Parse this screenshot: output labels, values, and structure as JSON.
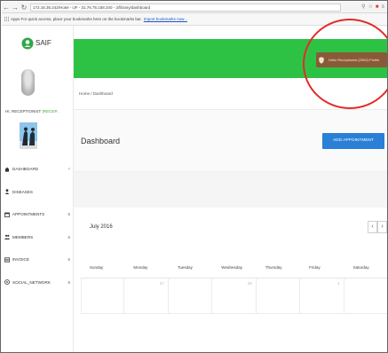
{
  "browser": {
    "url": "172.16.36.242/Hotel - UF - 31.76.75.158.340 - 2/library/dashboard",
    "bookmarks_text": "Apps  For quick access, place your bookmarks here on the bookmarks bar.",
    "bookmarks_link": "Import bookmarks now..."
  },
  "app": {
    "logo_text": "SAIF",
    "user_name_prefix": "HI, RECEPTIONIST ",
    "user_name_accent": "(RECEP..",
    "user_pill_text": "Hello Receptionist (2000)  Profile",
    "breadcrumb": "Home / Dashboard",
    "page_title": "Dashboard",
    "add_button": "ADD APPOINTMENT"
  },
  "sidebar": {
    "items": [
      {
        "label": "DASHBOARD",
        "count": "",
        "icon": "home-icon"
      },
      {
        "label": "DISEASES",
        "count": "",
        "icon": "user-icon"
      },
      {
        "label": "APPOINTMENTS",
        "count": "6",
        "icon": "calendar-icon"
      },
      {
        "label": "MEMBERS",
        "count": "6",
        "icon": "users-icon"
      },
      {
        "label": "INVOICE",
        "count": "6",
        "icon": "invoice-icon"
      },
      {
        "label": "SOCIAL_NETWORK",
        "count": "6",
        "icon": "network-icon"
      }
    ]
  },
  "calendar": {
    "month": "July 2016",
    "prev": "‹",
    "next": "›",
    "days": [
      "Sunday",
      "Monday",
      "Tuesday",
      "Wednesday",
      "Thursday",
      "Friday",
      "Saturday"
    ],
    "first_row": [
      "",
      "27",
      "",
      "29",
      "",
      "1",
      ""
    ]
  },
  "colors": {
    "header_green": "#2ec245",
    "button_blue": "#2a7fd6",
    "pill_brown": "#8a5a38",
    "annotation_red": "#e32b2b"
  }
}
